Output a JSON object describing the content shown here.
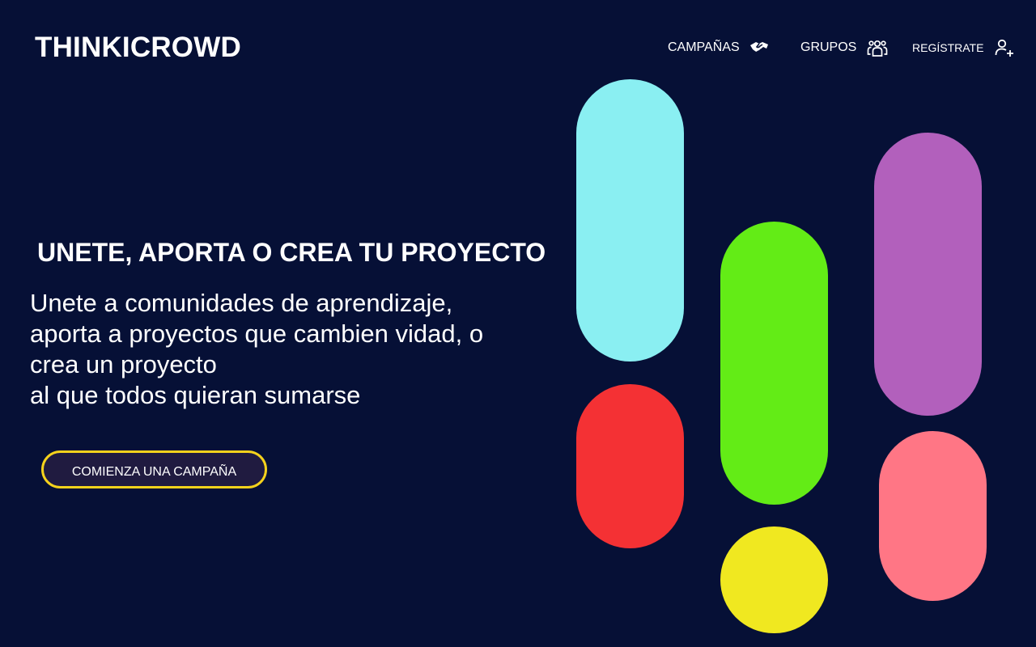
{
  "brand": {
    "logo_text": "THINKICROWD"
  },
  "nav": {
    "items": [
      {
        "label": "CAMPAÑAS",
        "icon": "handshake-icon"
      },
      {
        "label": "GRUPOS",
        "icon": "users-group-icon"
      },
      {
        "label": "REGÍSTRATE",
        "icon": "user-plus-icon"
      }
    ]
  },
  "hero": {
    "headline": "UNETE, APORTA O CREA TU PROYECTO",
    "subtitle_lines": [
      "Unete a comunidades de aprendizaje,",
      "aporta a proyectos que cambien vidad, o",
      "crea un proyecto",
      "al que todos quieran sumarse"
    ],
    "cta_label": "COMIENZA UNA CAMPAÑA"
  },
  "colors": {
    "background": "#061036",
    "cta_border": "#f5d21c",
    "cta_fill": "#201b40",
    "pill_cyan": "#8aeff2",
    "pill_red": "#f43134",
    "pill_green": "#63ec16",
    "pill_yellow": "#f0e820",
    "pill_purple": "#b260bc",
    "pill_pink": "#ff7685"
  }
}
